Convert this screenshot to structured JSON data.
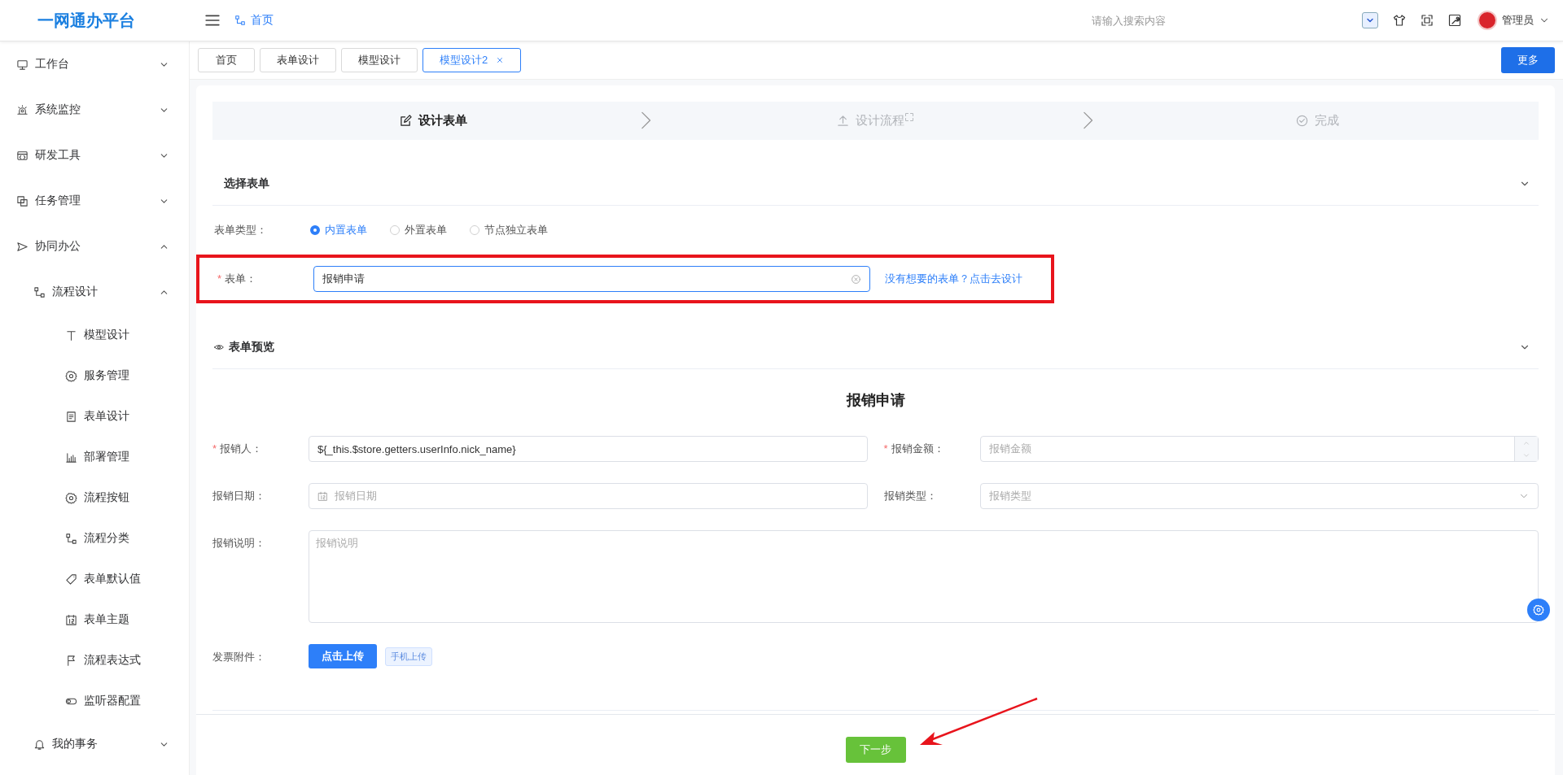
{
  "app": {
    "title": "一网通办平台"
  },
  "header": {
    "breadcrumb": "首页",
    "search": {
      "placeholder": "请输入搜索内容"
    },
    "user": "管理员"
  },
  "sidebar": {
    "items": [
      {
        "label": "工作台",
        "expanded": false
      },
      {
        "label": "系统监控",
        "expanded": false
      },
      {
        "label": "研发工具",
        "expanded": false
      },
      {
        "label": "任务管理",
        "expanded": false
      },
      {
        "label": "协同办公",
        "expanded": true,
        "children": [
          {
            "label": "流程设计",
            "expanded": true,
            "children": [
              {
                "label": "模型设计"
              },
              {
                "label": "服务管理"
              },
              {
                "label": "表单设计"
              },
              {
                "label": "部署管理"
              },
              {
                "label": "流程按钮"
              },
              {
                "label": "流程分类"
              },
              {
                "label": "表单默认值"
              },
              {
                "label": "表单主题"
              },
              {
                "label": "流程表达式"
              },
              {
                "label": "监听器配置"
              }
            ]
          },
          {
            "label": "我的事务",
            "expanded": false
          }
        ]
      }
    ]
  },
  "tabs": [
    {
      "label": "首页",
      "selected": false,
      "closable": false
    },
    {
      "label": "表单设计",
      "selected": false,
      "closable": false
    },
    {
      "label": "模型设计",
      "selected": false,
      "closable": false
    },
    {
      "label": "模型设计2",
      "selected": true,
      "closable": true
    }
  ],
  "more_button": "更多",
  "steps": [
    {
      "label": "设计表单",
      "active": true
    },
    {
      "label": "设计流程",
      "active": false
    },
    {
      "label": "完成",
      "active": false
    }
  ],
  "select_form": {
    "title": "选择表单",
    "expanded": true,
    "type_label": "表单类型：",
    "types": [
      {
        "label": "内置表单",
        "selected": true
      },
      {
        "label": "外置表单",
        "selected": false
      },
      {
        "label": "节点独立表单",
        "selected": false
      }
    ],
    "form_field": {
      "required_mark": "*",
      "label": "表单：",
      "value": "报销申请"
    },
    "design_link": "没有想要的表单？点击去设计"
  },
  "preview": {
    "title": "表单预览",
    "expanded": true,
    "form_title": "报销申请",
    "fields": [
      {
        "kind": "text",
        "required_mark": "*",
        "label": "报销人：",
        "value": "${_this.$store.getters.userInfo.nick_name}"
      },
      {
        "kind": "number",
        "required_mark": "*",
        "label": "报销金额：",
        "placeholder": "报销金额"
      },
      {
        "kind": "date",
        "label": "报销日期：",
        "placeholder": "报销日期"
      },
      {
        "kind": "select",
        "label": "报销类型：",
        "placeholder": "报销类型"
      },
      {
        "kind": "textarea",
        "label": "报销说明：",
        "placeholder": "报销说明"
      },
      {
        "kind": "upload",
        "label": "发票附件：",
        "button": "点击上传",
        "tag": "手机上传"
      }
    ]
  },
  "next_button": "下一步"
}
